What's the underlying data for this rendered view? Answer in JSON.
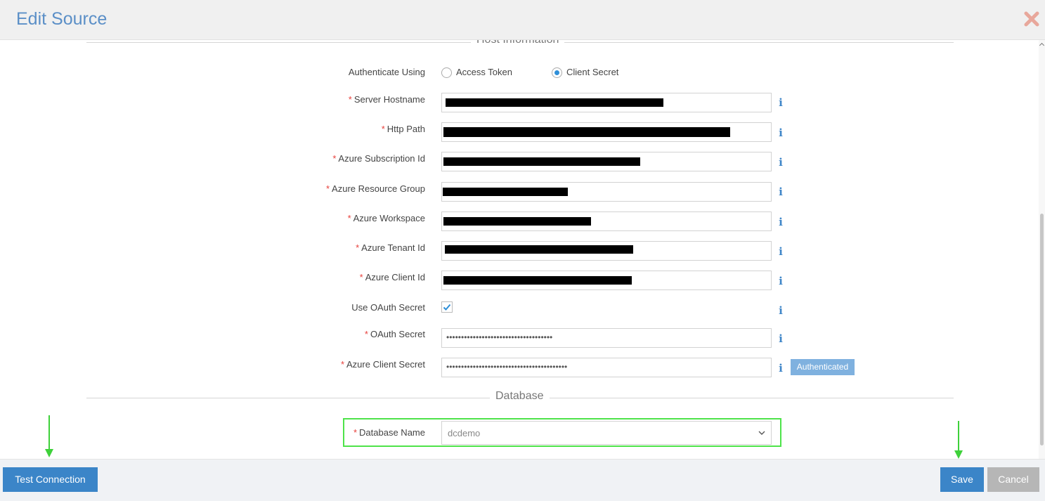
{
  "dialog": {
    "title": "Edit Source"
  },
  "host_section": {
    "title": "Host Information"
  },
  "auth": {
    "label": "Authenticate Using",
    "options": [
      "Access Token",
      "Client Secret"
    ],
    "selected": "Client Secret"
  },
  "fields": {
    "server_hostname": "Server Hostname",
    "http_path": "Http Path",
    "azure_subscription_id": "Azure Subscription Id",
    "azure_resource_group": "Azure Resource Group",
    "azure_workspace": "Azure Workspace",
    "azure_tenant_id": "Azure Tenant Id",
    "azure_client_id": "Azure Client Id",
    "use_oauth_secret": "Use OAuth Secret",
    "oauth_secret": "OAuth Secret",
    "azure_client_secret": "Azure Client Secret"
  },
  "required_mark": "*",
  "use_oauth_secret_checked": true,
  "masked_values": {
    "oauth_secret": "••••••••••••••••••••••••••••••••••••",
    "azure_client_secret": "•••••••••••••••••••••••••••••••••••••••••"
  },
  "badge": {
    "authenticated": "Authenticated"
  },
  "info_glyph": "i",
  "database_section": {
    "title": "Database",
    "name_label": "Database Name",
    "name_value": "dcdemo"
  },
  "footer": {
    "test_connection": "Test Connection",
    "save": "Save",
    "cancel": "Cancel"
  },
  "colors": {
    "accent": "#3b85c8",
    "title": "#5b8fc7",
    "required": "#e8413c",
    "highlight": "#4ee34a",
    "badge": "#7fb1df"
  },
  "icons": [
    "close-icon",
    "info-icon",
    "check-icon",
    "chevron-down-icon",
    "arrow-down-icon"
  ]
}
